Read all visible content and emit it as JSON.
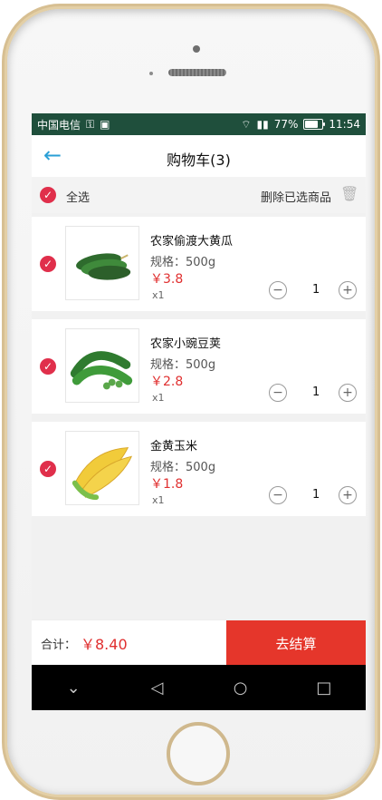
{
  "status_bar": {
    "carrier": "中国电信",
    "battery_percent": "77%",
    "time": "11:54",
    "battery_level": 0.77
  },
  "header": {
    "title": "购物车(3)"
  },
  "select_all": {
    "label": "全选",
    "delete_label": "删除已选商品"
  },
  "items": [
    {
      "name": "农家偷渡大黄瓜",
      "spec": "规格：500g",
      "price": "￥3.8",
      "multiplier": "x1",
      "quantity": "1",
      "image_icon": "cucumber-icon"
    },
    {
      "name": "农家小豌豆荚",
      "spec": "规格：500g",
      "price": "￥2.8",
      "multiplier": "x1",
      "quantity": "1",
      "image_icon": "peas-icon"
    },
    {
      "name": "金黄玉米",
      "spec": "规格：500g",
      "price": "￥1.8",
      "multiplier": "x1",
      "quantity": "1",
      "image_icon": "corn-icon"
    }
  ],
  "footer": {
    "total_label": "合计：",
    "total_value": "￥8.40",
    "checkout_label": "去结算"
  },
  "colors": {
    "accent_red": "#e02f4b",
    "checkout_red": "#e5362b",
    "statusbar_green": "#1f4f3c",
    "back_blue": "#2a9fd6"
  }
}
